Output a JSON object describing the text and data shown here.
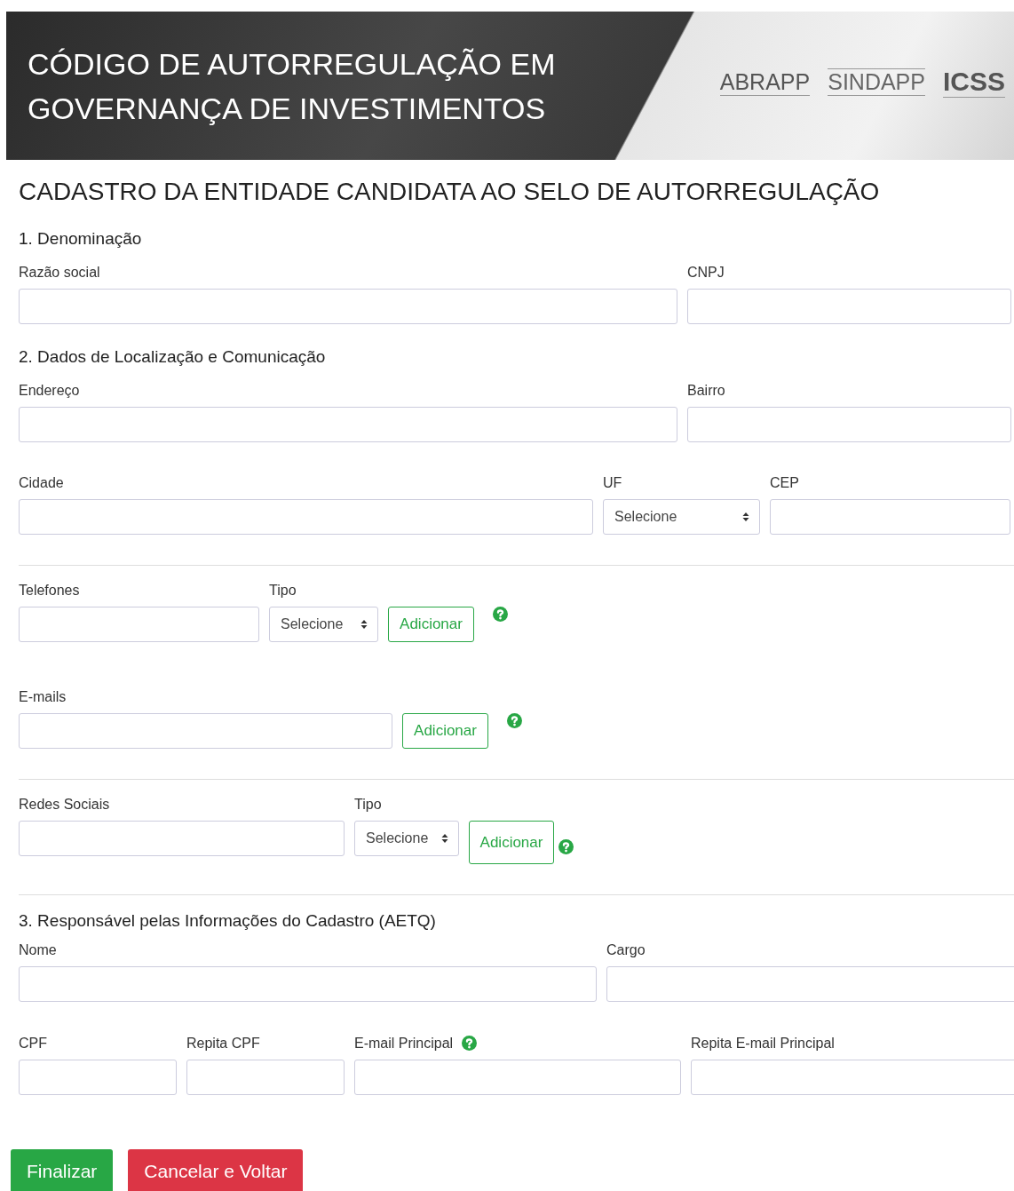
{
  "banner": {
    "title_lines": [
      "CÓDIGO DE AUTORREGULAÇÃO EM",
      "GOVERNANÇA DE INVESTIMENTOS"
    ],
    "logos": [
      "ABRAPP",
      "SINDAPP",
      "ICSS"
    ]
  },
  "heading": "CADASTRO DA ENTIDADE CANDIDATA AO SELO DE AUTORREGULAÇÃO",
  "rows": [
    {
      "kind": "title",
      "text": "1. Denominação"
    },
    {
      "kind": "fields",
      "items": [
        {
          "kind": "input",
          "label": "Razão social"
        },
        {
          "kind": "input",
          "label": "CNPJ"
        }
      ]
    },
    {
      "kind": "title",
      "text": "2. Dados de Localização e Comunicação"
    },
    {
      "kind": "fields",
      "items": [
        {
          "kind": "input",
          "label": "Endereço"
        },
        {
          "kind": "input",
          "label": "Bairro"
        }
      ]
    },
    {
      "kind": "fields",
      "items": [
        {
          "kind": "input",
          "label": "Cidade"
        },
        {
          "kind": "select",
          "label": "UF",
          "value": "Selecione"
        },
        {
          "kind": "input",
          "label": "CEP"
        }
      ]
    },
    {
      "kind": "divider"
    },
    {
      "kind": "fields",
      "items": [
        {
          "kind": "input",
          "label": "Telefones"
        },
        {
          "kind": "select",
          "label": "Tipo",
          "value": "Selecione"
        },
        {
          "kind": "button",
          "label": "Adicionar"
        },
        {
          "kind": "help"
        }
      ]
    },
    {
      "kind": "fields",
      "items": [
        {
          "kind": "input",
          "label": "E-mails"
        },
        {
          "kind": "button",
          "label": "Adicionar"
        },
        {
          "kind": "help"
        }
      ]
    },
    {
      "kind": "divider"
    },
    {
      "kind": "fields",
      "items": [
        {
          "kind": "input",
          "label": "Redes Sociais"
        },
        {
          "kind": "select",
          "label": "Tipo",
          "value": "Selecione"
        },
        {
          "kind": "button",
          "label": "Adicionar"
        },
        {
          "kind": "help"
        }
      ]
    },
    {
      "kind": "divider"
    },
    {
      "kind": "title",
      "text": "3. Responsável pelas Informações do Cadastro (AETQ)"
    },
    {
      "kind": "fields",
      "items": [
        {
          "kind": "input",
          "label": "Nome"
        },
        {
          "kind": "input",
          "label": "Cargo"
        }
      ]
    },
    {
      "kind": "fields",
      "items": [
        {
          "kind": "input",
          "label": "CPF"
        },
        {
          "kind": "input",
          "label": "Repita CPF"
        },
        {
          "kind": "input",
          "label": "E-mail Principal",
          "help": true
        },
        {
          "kind": "input",
          "label": "Repita E-mail Principal"
        }
      ]
    }
  ],
  "actions": [
    {
      "kind": "success",
      "label": "Finalizar"
    },
    {
      "kind": "danger",
      "label": "Cancelar e Voltar"
    }
  ]
}
